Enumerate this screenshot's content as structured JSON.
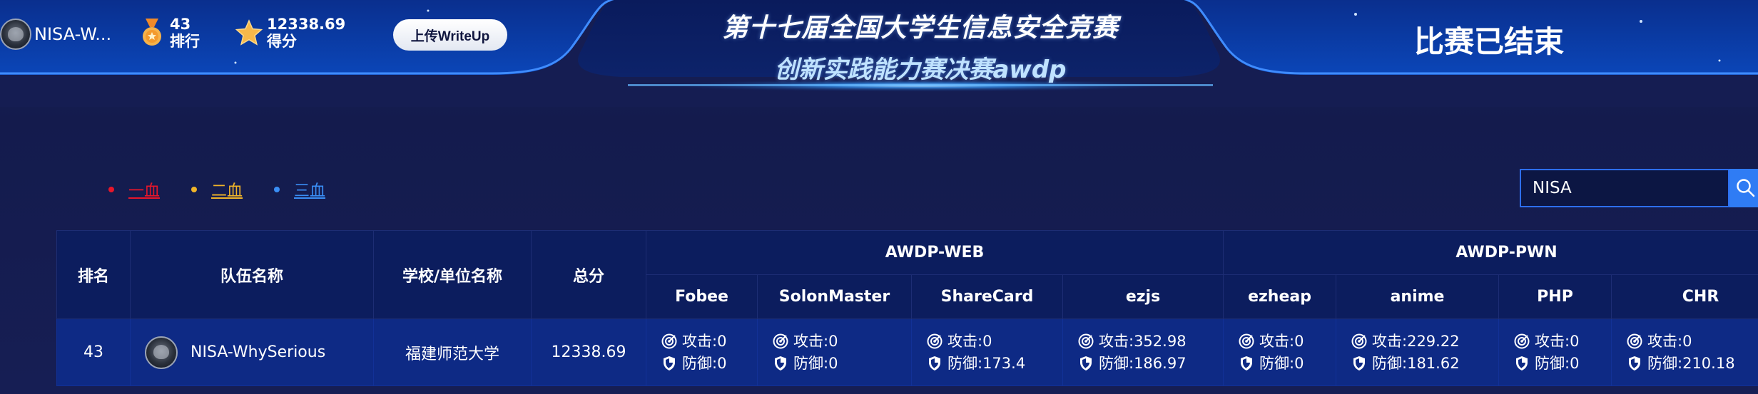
{
  "header": {
    "user_name": "NISA-W...",
    "rank_value": "43",
    "rank_label": "排行",
    "score_value": "12338.69",
    "score_label": "得分",
    "upload_label": "上传WriteUp",
    "title_line1": "第十七届全国大学生信息安全竞赛",
    "title_line2": "创新实践能力赛决赛awdp",
    "status": "比赛已结束"
  },
  "legend": [
    {
      "label": "一血",
      "color": "#e8162a"
    },
    {
      "label": "二血",
      "color": "#f0b429"
    },
    {
      "label": "三血",
      "color": "#3a8ef5"
    }
  ],
  "search": {
    "value": "NISA"
  },
  "table": {
    "headers": {
      "rank": "排名",
      "team": "队伍名称",
      "school": "学校/单位名称",
      "total": "总分",
      "group_web": "AWDP-WEB",
      "group_pwn": "AWDP-PWN"
    },
    "challenges": [
      "Fobee",
      "SolonMaster",
      "ShareCard",
      "ezjs",
      "ezheap",
      "anime",
      "PHP",
      "CHR"
    ],
    "row": {
      "rank": "43",
      "team": "NISA-WhySerious",
      "school": "福建师范大学",
      "total": "12338.69",
      "scores": [
        {
          "attack": "攻击:0",
          "defense": "防御:0"
        },
        {
          "attack": "攻击:0",
          "defense": "防御:0"
        },
        {
          "attack": "攻击:0",
          "defense": "防御:173.4"
        },
        {
          "attack": "攻击:352.98",
          "defense": "防御:186.97"
        },
        {
          "attack": "攻击:0",
          "defense": "防御:0"
        },
        {
          "attack": "攻击:229.22",
          "defense": "防御:181.62"
        },
        {
          "attack": "攻击:0",
          "defense": "防御:0"
        },
        {
          "attack": "攻击:0",
          "defense": "防御:210.18"
        }
      ]
    }
  }
}
